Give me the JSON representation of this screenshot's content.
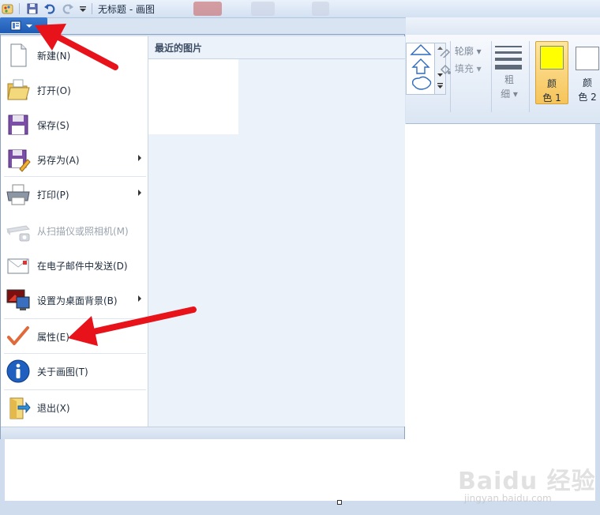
{
  "window": {
    "title": "无标题 - 画图"
  },
  "quick_access": {
    "icons": [
      "paint-app-icon",
      "save-icon",
      "undo-icon",
      "redo-icon",
      "customize-dropdown-icon"
    ]
  },
  "app_menu": {
    "button_icon": "app-menu-icon",
    "recent_header": "最近的图片",
    "items": [
      {
        "label": "新建(N)",
        "icon": "new-file-icon",
        "enabled": true,
        "submenu": false
      },
      {
        "label": "打开(O)",
        "icon": "open-folder-icon",
        "enabled": true,
        "submenu": false
      },
      {
        "label": "保存(S)",
        "icon": "save-icon",
        "enabled": true,
        "submenu": false
      },
      {
        "label": "另存为(A)",
        "icon": "save-as-icon",
        "enabled": true,
        "submenu": true
      },
      {
        "label": "打印(P)",
        "icon": "printer-icon",
        "enabled": true,
        "submenu": true
      },
      {
        "label": "从扫描仪或照相机(M)",
        "icon": "scanner-icon",
        "enabled": false,
        "submenu": false
      },
      {
        "label": "在电子邮件中发送(D)",
        "icon": "email-icon",
        "enabled": true,
        "submenu": false
      },
      {
        "label": "设置为桌面背景(B)",
        "icon": "desktop-background-icon",
        "enabled": true,
        "submenu": true
      },
      {
        "label": "属性(E)",
        "icon": "checkmark-icon",
        "enabled": true,
        "submenu": false
      },
      {
        "label": "关于画图(T)",
        "icon": "info-icon",
        "enabled": true,
        "submenu": false
      },
      {
        "label": "退出(X)",
        "icon": "exit-icon",
        "enabled": true,
        "submenu": false
      }
    ]
  },
  "ribbon": {
    "outline_label": "轮廓",
    "fill_label": "填充",
    "size_label_1": "粗",
    "size_label_2": "细",
    "color1_label_1": "颜",
    "color1_label_2": "色 1",
    "color2_label_1": "颜",
    "color2_label_2": "色 2",
    "color1_value": "#ffff00",
    "color2_value": "#ffffff"
  },
  "annotations": {
    "arrow_color": "#e8121a"
  },
  "watermark": {
    "brand": "Baidu 经验",
    "url": "jingyan.baidu.com"
  }
}
